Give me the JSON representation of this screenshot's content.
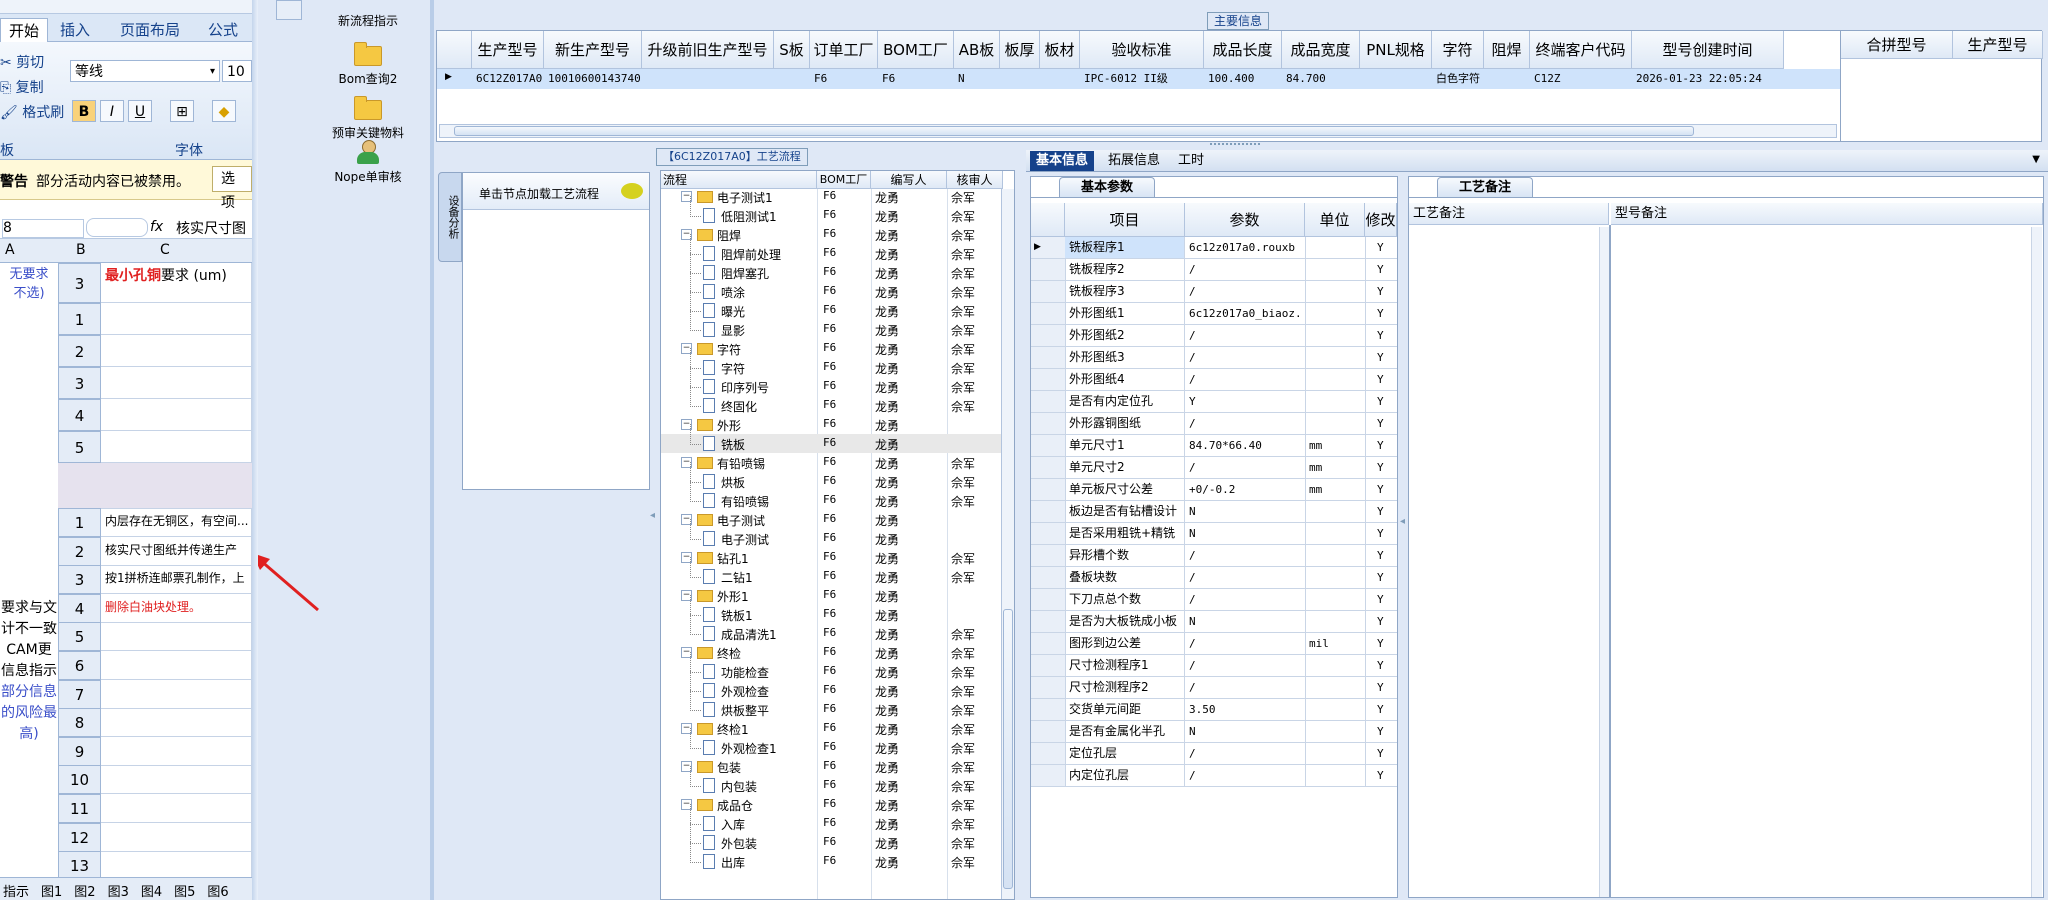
{
  "excel": {
    "tabs": [
      "开始",
      "插入",
      "页面布局",
      "公式"
    ],
    "clipboard": {
      "cut": "剪切",
      "copy": "复制",
      "format_painter": "格式刷",
      "group": "板"
    },
    "font": {
      "name": "等线",
      "size": "10",
      "group": "字体"
    },
    "warning": {
      "label": "警告",
      "text": "部分活动内容已被禁用。",
      "button": "选项"
    },
    "namebox": "8",
    "formula": "核实尺寸图",
    "columns": [
      "A",
      "B",
      "C"
    ],
    "header_row": {
      "a": "无要求\n不选)",
      "num": "3",
      "text_red": "最小孔铜",
      "text": "要求\n(um)"
    },
    "rows1": [
      {
        "n": "1",
        "t": ""
      },
      {
        "n": "2",
        "t": ""
      },
      {
        "n": "3",
        "t": ""
      },
      {
        "n": "4",
        "t": ""
      },
      {
        "n": "5",
        "t": ""
      }
    ],
    "rows2": [
      {
        "n": "1",
        "t": "内层存在无铜区，有空间..."
      },
      {
        "n": "2",
        "t": "核实尺寸图纸并传递生产"
      },
      {
        "n": "3",
        "t": "按1拼桥连邮票孔制作，上"
      },
      {
        "n": "4",
        "t": "删除白油块处理。",
        "red": true
      },
      {
        "n": "5",
        "t": ""
      },
      {
        "n": "6",
        "t": ""
      },
      {
        "n": "7",
        "t": ""
      },
      {
        "n": "8",
        "t": ""
      },
      {
        "n": "9",
        "t": ""
      },
      {
        "n": "10",
        "t": ""
      },
      {
        "n": "11",
        "t": ""
      },
      {
        "n": "12",
        "t": ""
      },
      {
        "n": "13",
        "t": ""
      }
    ],
    "side_note": [
      "要求与文",
      "计不一致",
      "CAM更",
      "信息指示",
      "部分信息",
      "的风险最",
      "高)"
    ],
    "sheet_tabs": [
      "指示",
      "图1",
      "图2",
      "图3",
      "图4",
      "图5",
      "图6"
    ]
  },
  "sidebar": {
    "items": [
      {
        "label": "新流程指示",
        "icon": "pencil-icon"
      },
      {
        "label": "Bom查询2",
        "icon": "folder-icon"
      },
      {
        "label": "预审关键物料",
        "icon": "folder-pencil-icon"
      },
      {
        "label": "Nope单审核",
        "icon": "user-icon"
      }
    ]
  },
  "main_info": {
    "title": "主要信息",
    "columns": [
      "生产型号",
      "新生产型号",
      "升级前旧生产型号",
      "S板",
      "订单工厂",
      "BOM工厂",
      "AB板",
      "板厚",
      "板材",
      "验收标准",
      "成品长度",
      "成品宽度",
      "PNL规格",
      "字符",
      "阻焊",
      "终端客户代码",
      "型号创建时间"
    ],
    "row": {
      "生产型号": "6C12Z017A0",
      "新生产型号": "10010600143740",
      "升级前旧生产型号": "",
      "S板": "",
      "订单工厂": "F6",
      "BOM工厂": "F6",
      "AB板": "N",
      "板厚": "",
      "板材": "",
      "验收标准": "IPC-6012 II级",
      "成品长度": "100.400",
      "成品宽度": "84.700",
      "PNL规格": "",
      "字符": "白色字符",
      "阻焊": "",
      "终端客户代码": "C12Z",
      "型号创建时间": "2026-01-23 22:05:24"
    },
    "side_columns": [
      "合拼型号",
      "生产型号"
    ]
  },
  "flow": {
    "vtab": "设备分析",
    "load_text": "单击节点加载工艺流程"
  },
  "process": {
    "title": "【6C12Z017A0】工艺流程",
    "columns": [
      "流程",
      "BOM工厂",
      "编写人",
      "核审人"
    ],
    "rows": [
      {
        "name": "电子测试1",
        "level": 0,
        "f": "F6",
        "w": "龙勇",
        "r": "佘军"
      },
      {
        "name": "低阻测试1",
        "level": 1,
        "f": "F6",
        "w": "龙勇",
        "r": "佘军"
      },
      {
        "name": "阻焊",
        "level": 0,
        "f": "F6",
        "w": "龙勇",
        "r": "佘军"
      },
      {
        "name": "阻焊前处理",
        "level": 1,
        "f": "F6",
        "w": "龙勇",
        "r": "佘军"
      },
      {
        "name": "阻焊塞孔",
        "level": 1,
        "f": "F6",
        "w": "龙勇",
        "r": "佘军"
      },
      {
        "name": "喷涂",
        "level": 1,
        "f": "F6",
        "w": "龙勇",
        "r": "佘军"
      },
      {
        "name": "曝光",
        "level": 1,
        "f": "F6",
        "w": "龙勇",
        "r": "佘军"
      },
      {
        "name": "显影",
        "level": 1,
        "f": "F6",
        "w": "龙勇",
        "r": "佘军"
      },
      {
        "name": "字符",
        "level": 0,
        "f": "F6",
        "w": "龙勇",
        "r": "佘军"
      },
      {
        "name": "字符",
        "level": 1,
        "f": "F6",
        "w": "龙勇",
        "r": "佘军"
      },
      {
        "name": "印序列号",
        "level": 1,
        "f": "F6",
        "w": "龙勇",
        "r": "佘军"
      },
      {
        "name": "终固化",
        "level": 1,
        "f": "F6",
        "w": "龙勇",
        "r": "佘军"
      },
      {
        "name": "外形",
        "level": 0,
        "f": "F6",
        "w": "龙勇",
        "r": ""
      },
      {
        "name": "铣板",
        "level": 1,
        "f": "F6",
        "w": "龙勇",
        "r": "",
        "sel": true
      },
      {
        "name": "有铅喷锡",
        "level": 0,
        "f": "F6",
        "w": "龙勇",
        "r": "佘军"
      },
      {
        "name": "烘板",
        "level": 1,
        "f": "F6",
        "w": "龙勇",
        "r": "佘军"
      },
      {
        "name": "有铅喷锡",
        "level": 1,
        "f": "F6",
        "w": "龙勇",
        "r": "佘军"
      },
      {
        "name": "电子测试",
        "level": 0,
        "f": "F6",
        "w": "龙勇",
        "r": ""
      },
      {
        "name": "电子测试",
        "level": 1,
        "f": "F6",
        "w": "龙勇",
        "r": ""
      },
      {
        "name": "钻孔1",
        "level": 0,
        "f": "F6",
        "w": "龙勇",
        "r": "佘军"
      },
      {
        "name": "二钻1",
        "level": 1,
        "f": "F6",
        "w": "龙勇",
        "r": "佘军"
      },
      {
        "name": "外形1",
        "level": 0,
        "f": "F6",
        "w": "龙勇",
        "r": ""
      },
      {
        "name": "铣板1",
        "level": 1,
        "f": "F6",
        "w": "龙勇",
        "r": ""
      },
      {
        "name": "成品清洗1",
        "level": 1,
        "f": "F6",
        "w": "龙勇",
        "r": "佘军"
      },
      {
        "name": "终检",
        "level": 0,
        "f": "F6",
        "w": "龙勇",
        "r": "佘军"
      },
      {
        "name": "功能检查",
        "level": 1,
        "f": "F6",
        "w": "龙勇",
        "r": "佘军"
      },
      {
        "name": "外观检查",
        "level": 1,
        "f": "F6",
        "w": "龙勇",
        "r": "佘军"
      },
      {
        "name": "烘板整平",
        "level": 1,
        "f": "F6",
        "w": "龙勇",
        "r": "佘军"
      },
      {
        "name": "终检1",
        "level": 0,
        "f": "F6",
        "w": "龙勇",
        "r": "佘军"
      },
      {
        "name": "外观检查1",
        "level": 1,
        "f": "F6",
        "w": "龙勇",
        "r": "佘军"
      },
      {
        "name": "包装",
        "level": 0,
        "f": "F6",
        "w": "龙勇",
        "r": "佘军"
      },
      {
        "name": "内包装",
        "level": 1,
        "f": "F6",
        "w": "龙勇",
        "r": "佘军"
      },
      {
        "name": "成品仓",
        "level": 0,
        "f": "F6",
        "w": "龙勇",
        "r": "佘军"
      },
      {
        "name": "入库",
        "level": 1,
        "f": "F6",
        "w": "龙勇",
        "r": "佘军"
      },
      {
        "name": "外包装",
        "level": 1,
        "f": "F6",
        "w": "龙勇",
        "r": "佘军"
      },
      {
        "name": "出库",
        "level": 1,
        "f": "F6",
        "w": "龙勇",
        "r": "佘军"
      }
    ]
  },
  "detail": {
    "tabs": [
      "基本信息",
      "拓展信息",
      "工时"
    ],
    "subtab": "基本参数",
    "columns": [
      "项目",
      "参数",
      "单位",
      "修改"
    ],
    "rows": [
      {
        "item": "铣板程序1",
        "param": "6c12z017a0.rouxb",
        "unit": "",
        "mod": "Y"
      },
      {
        "item": "铣板程序2",
        "param": "/",
        "unit": "",
        "mod": "Y"
      },
      {
        "item": "铣板程序3",
        "param": "/",
        "unit": "",
        "mod": "Y"
      },
      {
        "item": "外形图纸1",
        "param": "6c12z017a0_biaoz...",
        "unit": "",
        "mod": "Y"
      },
      {
        "item": "外形图纸2",
        "param": "/",
        "unit": "",
        "mod": "Y"
      },
      {
        "item": "外形图纸3",
        "param": "/",
        "unit": "",
        "mod": "Y"
      },
      {
        "item": "外形图纸4",
        "param": "/",
        "unit": "",
        "mod": "Y"
      },
      {
        "item": "是否有内定位孔",
        "param": "Y",
        "unit": "",
        "mod": "Y"
      },
      {
        "item": "外形露铜图纸",
        "param": "/",
        "unit": "",
        "mod": "Y"
      },
      {
        "item": "单元尺寸1",
        "param": "84.70*66.40",
        "unit": "mm",
        "mod": "Y"
      },
      {
        "item": "单元尺寸2",
        "param": "/",
        "unit": "mm",
        "mod": "Y"
      },
      {
        "item": "单元板尺寸公差",
        "param": "+0/-0.2",
        "unit": "mm",
        "mod": "Y"
      },
      {
        "item": "板边是否有钻槽设计",
        "param": "N",
        "unit": "",
        "mod": "Y"
      },
      {
        "item": "是否采用粗铣+精铣",
        "param": "N",
        "unit": "",
        "mod": "Y"
      },
      {
        "item": "异形槽个数",
        "param": "/",
        "unit": "",
        "mod": "Y"
      },
      {
        "item": "叠板块数",
        "param": "/",
        "unit": "",
        "mod": "Y"
      },
      {
        "item": "下刀点总个数",
        "param": "/",
        "unit": "",
        "mod": "Y"
      },
      {
        "item": "是否为大板铣成小板",
        "param": "N",
        "unit": "",
        "mod": "Y"
      },
      {
        "item": "图形到边公差",
        "param": "/",
        "unit": "mil",
        "mod": "Y"
      },
      {
        "item": "尺寸检测程序1",
        "param": "/",
        "unit": "",
        "mod": "Y"
      },
      {
        "item": "尺寸检测程序2",
        "param": "/",
        "unit": "",
        "mod": "Y"
      },
      {
        "item": "交货单元间距",
        "param": "3.50",
        "unit": "",
        "mod": "Y"
      },
      {
        "item": "是否有金属化半孔",
        "param": "N",
        "unit": "",
        "mod": "Y"
      },
      {
        "item": "定位孔层",
        "param": "/",
        "unit": "",
        "mod": "Y"
      },
      {
        "item": "内定位孔层",
        "param": "/",
        "unit": "",
        "mod": "Y"
      }
    ]
  },
  "remarks": {
    "tab": "工艺备注",
    "columns": [
      "工艺备注",
      "型号备注"
    ]
  },
  "colors": {
    "selection": "#cfe3fb",
    "accent": "#15428b",
    "header": "#dfe9f6",
    "red": "#e02020"
  }
}
